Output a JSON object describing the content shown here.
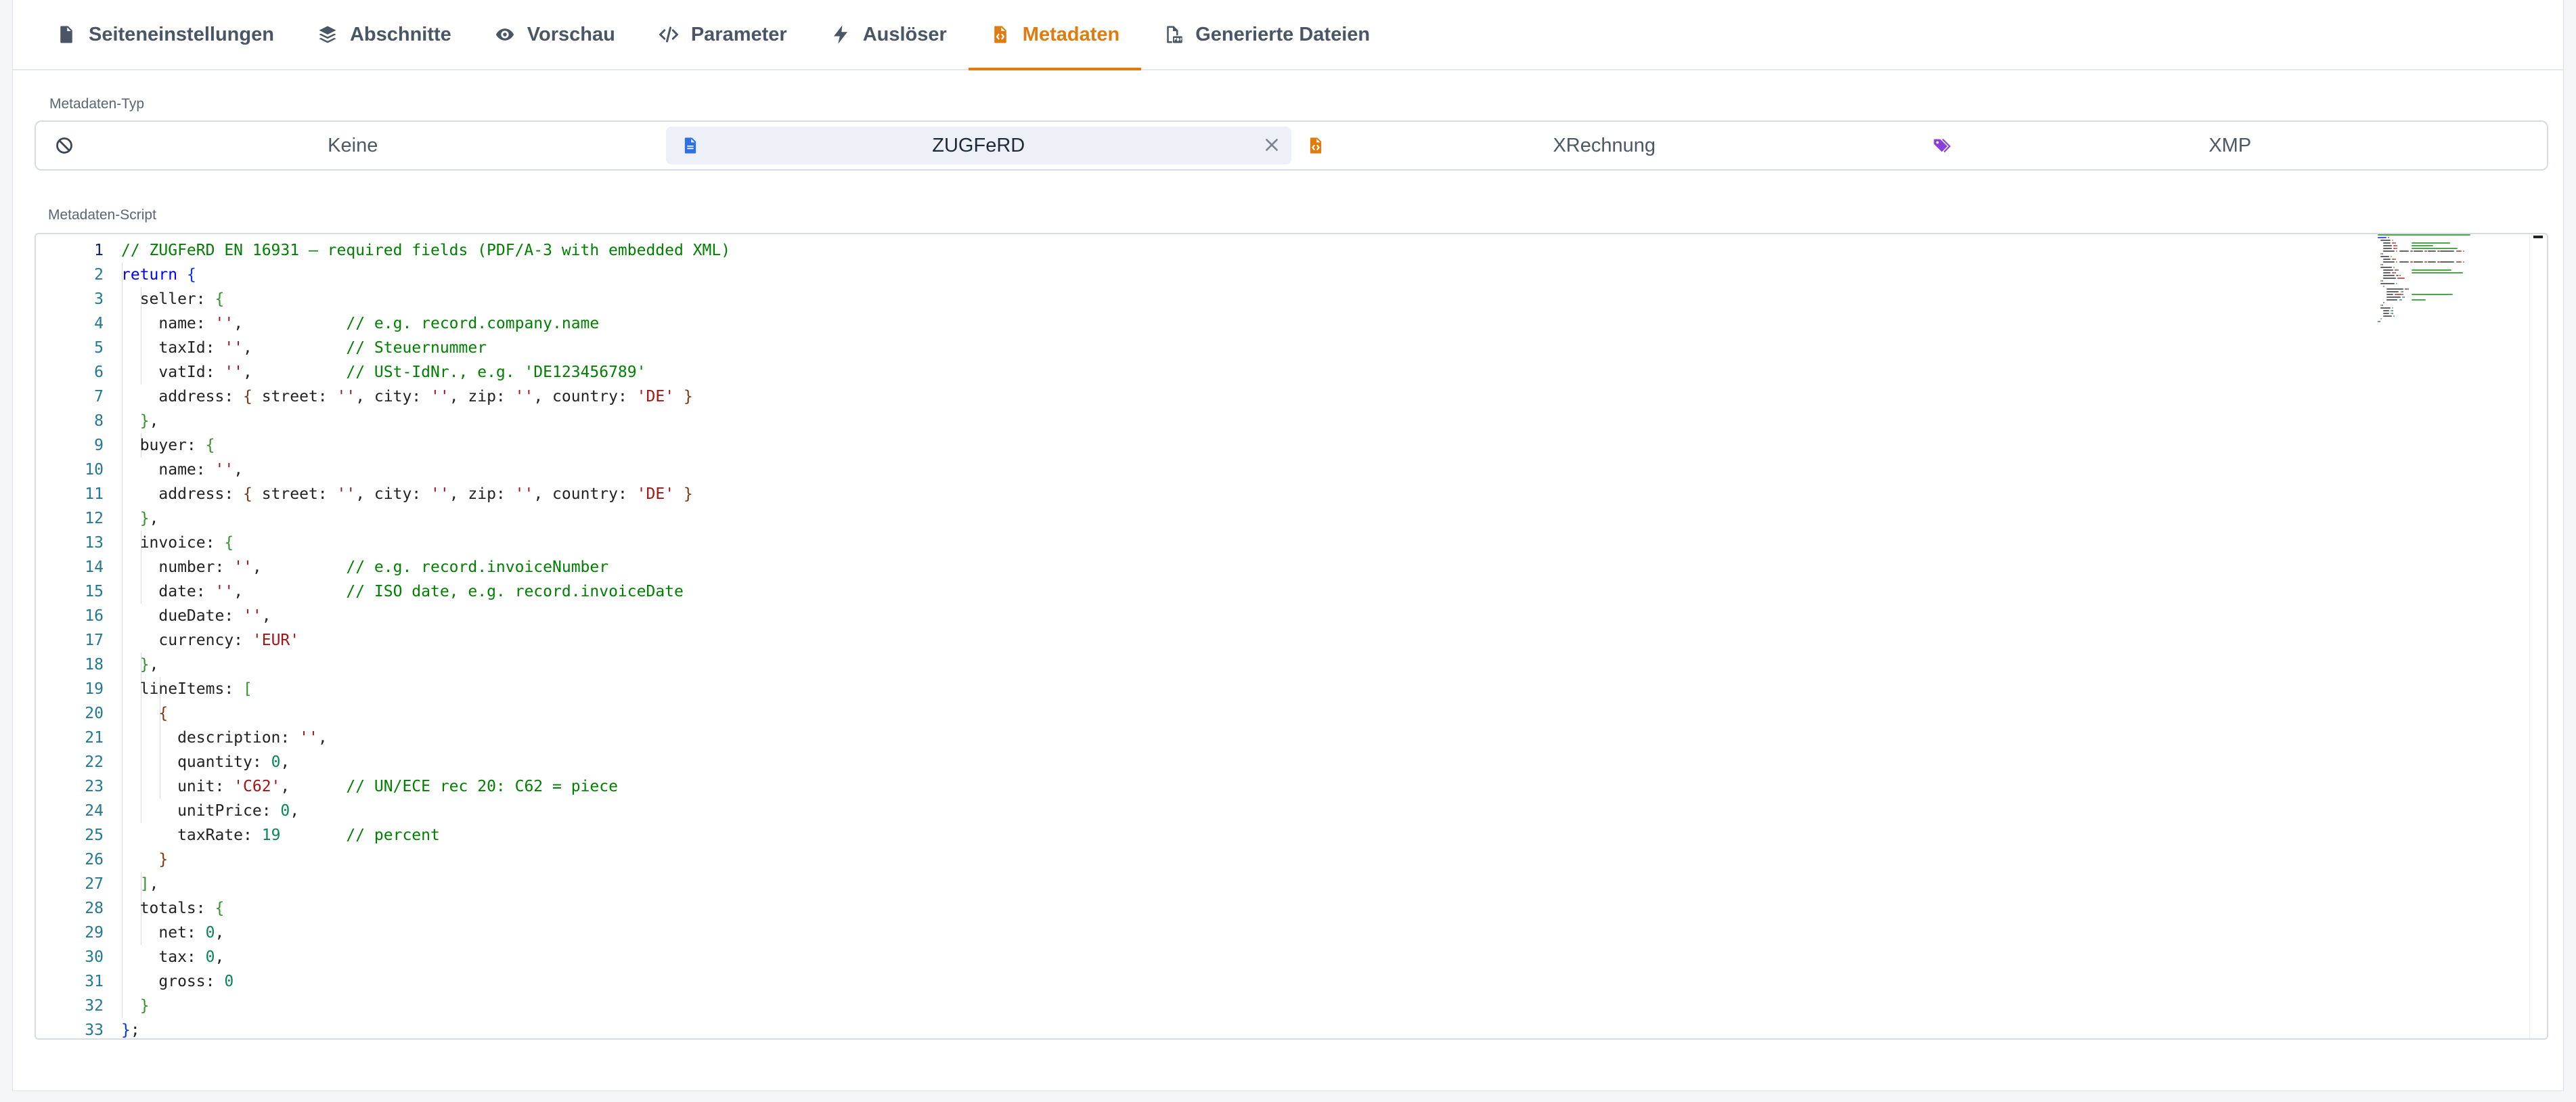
{
  "tabs": [
    {
      "label": "Seiteneinstellungen",
      "icon": "document-icon"
    },
    {
      "label": "Abschnitte",
      "icon": "layers-icon"
    },
    {
      "label": "Vorschau",
      "icon": "eye-icon"
    },
    {
      "label": "Parameter",
      "icon": "code-icon"
    },
    {
      "label": "Auslöser",
      "icon": "bolt-icon"
    },
    {
      "label": "Metadaten",
      "icon": "file-code-icon",
      "active": true
    },
    {
      "label": "Generierte Dateien",
      "icon": "pdf-file-icon"
    }
  ],
  "metadata_type": {
    "label": "Metadaten-Typ",
    "options": [
      {
        "label": "Keine",
        "icon": "ban-icon"
      },
      {
        "label": "ZUGFeRD",
        "icon": "file-icon",
        "active": true
      },
      {
        "label": "XRechnung",
        "icon": "file-code-icon"
      },
      {
        "label": "XMP",
        "icon": "tags-icon"
      }
    ]
  },
  "script": {
    "label": "Metadaten-Script",
    "current_line": 1,
    "lines": [
      [
        [
          "cm",
          "// ZUGFeRD EN 16931 – required fields (PDF/A-3 with embedded XML)"
        ]
      ],
      [
        [
          "kw",
          "return "
        ],
        [
          "b1",
          "{"
        ]
      ],
      [
        [
          "p",
          "  seller: "
        ],
        [
          "b2",
          "{"
        ]
      ],
      [
        [
          "p",
          "    name: "
        ],
        [
          "str",
          "''"
        ],
        [
          "p",
          ",           "
        ],
        [
          "cm",
          "// e.g. record.company.name"
        ]
      ],
      [
        [
          "p",
          "    taxId: "
        ],
        [
          "str",
          "''"
        ],
        [
          "p",
          ",          "
        ],
        [
          "cm",
          "// Steuernummer"
        ]
      ],
      [
        [
          "p",
          "    vatId: "
        ],
        [
          "str",
          "''"
        ],
        [
          "p",
          ",          "
        ],
        [
          "cm",
          "// USt-IdNr., e.g. 'DE123456789'"
        ]
      ],
      [
        [
          "p",
          "    address: "
        ],
        [
          "b3",
          "{"
        ],
        [
          "p",
          " street: "
        ],
        [
          "str",
          "''"
        ],
        [
          "p",
          ", city: "
        ],
        [
          "str",
          "''"
        ],
        [
          "p",
          ", zip: "
        ],
        [
          "str",
          "''"
        ],
        [
          "p",
          ", country: "
        ],
        [
          "str",
          "'DE'"
        ],
        [
          "p",
          " "
        ],
        [
          "b3",
          "}"
        ]
      ],
      [
        [
          "p",
          "  "
        ],
        [
          "b2",
          "}"
        ],
        [
          "p",
          ","
        ]
      ],
      [
        [
          "p",
          "  buyer: "
        ],
        [
          "b2",
          "{"
        ]
      ],
      [
        [
          "p",
          "    name: "
        ],
        [
          "str",
          "''"
        ],
        [
          "p",
          ","
        ]
      ],
      [
        [
          "p",
          "    address: "
        ],
        [
          "b3",
          "{"
        ],
        [
          "p",
          " street: "
        ],
        [
          "str",
          "''"
        ],
        [
          "p",
          ", city: "
        ],
        [
          "str",
          "''"
        ],
        [
          "p",
          ", zip: "
        ],
        [
          "str",
          "''"
        ],
        [
          "p",
          ", country: "
        ],
        [
          "str",
          "'DE'"
        ],
        [
          "p",
          " "
        ],
        [
          "b3",
          "}"
        ]
      ],
      [
        [
          "p",
          "  "
        ],
        [
          "b2",
          "}"
        ],
        [
          "p",
          ","
        ]
      ],
      [
        [
          "p",
          "  invoice: "
        ],
        [
          "b2",
          "{"
        ]
      ],
      [
        [
          "p",
          "    number: "
        ],
        [
          "str",
          "''"
        ],
        [
          "p",
          ",         "
        ],
        [
          "cm",
          "// e.g. record.invoiceNumber"
        ]
      ],
      [
        [
          "p",
          "    date: "
        ],
        [
          "str",
          "''"
        ],
        [
          "p",
          ",           "
        ],
        [
          "cm",
          "// ISO date, e.g. record.invoiceDate"
        ]
      ],
      [
        [
          "p",
          "    dueDate: "
        ],
        [
          "str",
          "''"
        ],
        [
          "p",
          ","
        ]
      ],
      [
        [
          "p",
          "    currency: "
        ],
        [
          "str",
          "'EUR'"
        ]
      ],
      [
        [
          "p",
          "  "
        ],
        [
          "b2",
          "}"
        ],
        [
          "p",
          ","
        ]
      ],
      [
        [
          "p",
          "  lineItems: "
        ],
        [
          "b2",
          "["
        ]
      ],
      [
        [
          "p",
          "    "
        ],
        [
          "b3",
          "{"
        ]
      ],
      [
        [
          "p",
          "      description: "
        ],
        [
          "str",
          "''"
        ],
        [
          "p",
          ","
        ]
      ],
      [
        [
          "p",
          "      quantity: "
        ],
        [
          "num",
          "0"
        ],
        [
          "p",
          ","
        ]
      ],
      [
        [
          "p",
          "      unit: "
        ],
        [
          "str",
          "'C62'"
        ],
        [
          "p",
          ",      "
        ],
        [
          "cm",
          "// UN/ECE rec 20: C62 = piece"
        ]
      ],
      [
        [
          "p",
          "      unitPrice: "
        ],
        [
          "num",
          "0"
        ],
        [
          "p",
          ","
        ]
      ],
      [
        [
          "p",
          "      taxRate: "
        ],
        [
          "num",
          "19"
        ],
        [
          "p",
          "       "
        ],
        [
          "cm",
          "// percent"
        ]
      ],
      [
        [
          "p",
          "    "
        ],
        [
          "b3",
          "}"
        ]
      ],
      [
        [
          "p",
          "  "
        ],
        [
          "b2",
          "]"
        ],
        [
          "p",
          ","
        ]
      ],
      [
        [
          "p",
          "  totals: "
        ],
        [
          "b2",
          "{"
        ]
      ],
      [
        [
          "p",
          "    net: "
        ],
        [
          "num",
          "0"
        ],
        [
          "p",
          ","
        ]
      ],
      [
        [
          "p",
          "    tax: "
        ],
        [
          "num",
          "0"
        ],
        [
          "p",
          ","
        ]
      ],
      [
        [
          "p",
          "    gross: "
        ],
        [
          "num",
          "0"
        ]
      ],
      [
        [
          "p",
          "  "
        ],
        [
          "b2",
          "}"
        ]
      ],
      [
        [
          "b1",
          "}"
        ],
        [
          "p",
          ";"
        ]
      ]
    ]
  }
}
